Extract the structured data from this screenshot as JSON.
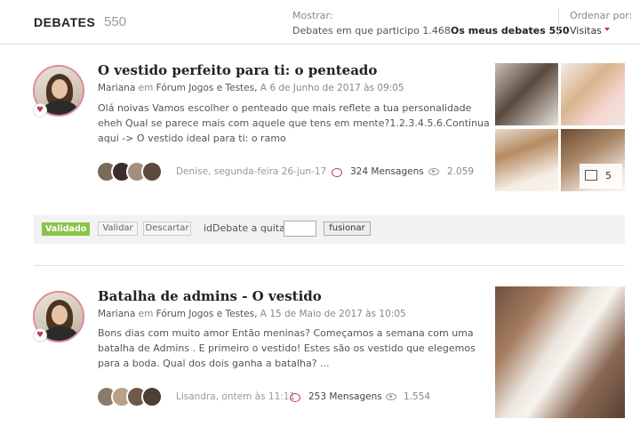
{
  "header": {
    "title": "DEBATES",
    "count": "550",
    "mostrar_label": "Mostrar:",
    "options": [
      "Debates em que participo 1.468",
      "Os meus debates 550"
    ],
    "ordenar_label": "Ordenar por:",
    "ordenar_value": "Visitas"
  },
  "posts": [
    {
      "title": "O vestido perfeito para ti: o penteado",
      "author": "Mariana",
      "em": "em",
      "forum": "Fórum Jogos e Testes,",
      "date": "A 6 de Junho de 2017 às 09:05",
      "excerpt_lines": [
        "Olá noivas Vamos escolher o penteado que mais reflete a tua personalidade",
        "eheh Qual se parece mais com aquele que tens em mente?1.2.3.4.5.6.Continua",
        "aqui -> O vestido ideal para ti: o ramo"
      ],
      "last_reply": "Denise, segunda-feira 26-jun-17",
      "messages": "324 Mensagens",
      "views": "2.059",
      "more_images": "5"
    },
    {
      "title": "Batalha de admins - O vestido",
      "author": "Mariana",
      "em": "em",
      "forum": "Fórum Jogos e Testes,",
      "date": "A 15 de Maio de 2017 às 10:05",
      "excerpt_lines": [
        "Bons dias com muito amor Então meninas? Começamos a semana com uma",
        "batalha de Admins . E primeiro o vestido! Estes são os vestido que elegemos",
        "para a boda. Qual dos dois ganha a batalha? ..."
      ],
      "last_reply": "Lisandra, ontem às 11:11",
      "messages": "253 Mensagens",
      "views": "1.554"
    }
  ],
  "moderation": {
    "status": "Validado",
    "validar": "Validar",
    "descartar": "Descartar",
    "quit_label": "idDebate a quitar",
    "quit_value": "",
    "fusionar": "fusionar"
  },
  "colors": {
    "accent": "#c0395a",
    "validated": "#8bc34a"
  }
}
